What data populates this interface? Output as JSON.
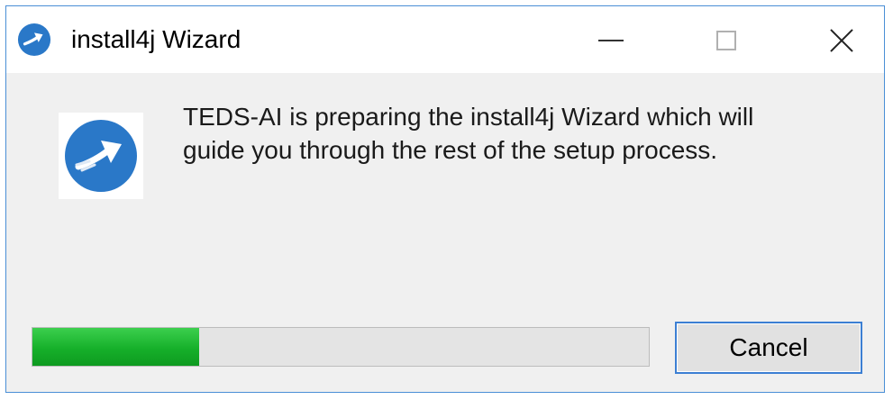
{
  "window": {
    "title": "install4j Wizard",
    "title_icon": "install4j-logo-icon",
    "controls": {
      "minimize_icon": "minimize-icon",
      "maximize_icon": "maximize-icon",
      "close_icon": "close-icon"
    }
  },
  "content": {
    "logo_icon": "install4j-logo-icon",
    "message_lines": [
      "TEDS-AI is preparing the install4j Wizard which will",
      "guide you through the rest of the setup process."
    ]
  },
  "progress": {
    "fraction": 0.27
  },
  "buttons": {
    "cancel_label": "Cancel"
  },
  "colors": {
    "logo_blue": "#2a78c8",
    "progress_green": "#16b02a",
    "window_border": "#4a8fd6",
    "button_focus_border": "#3c7fd3"
  }
}
